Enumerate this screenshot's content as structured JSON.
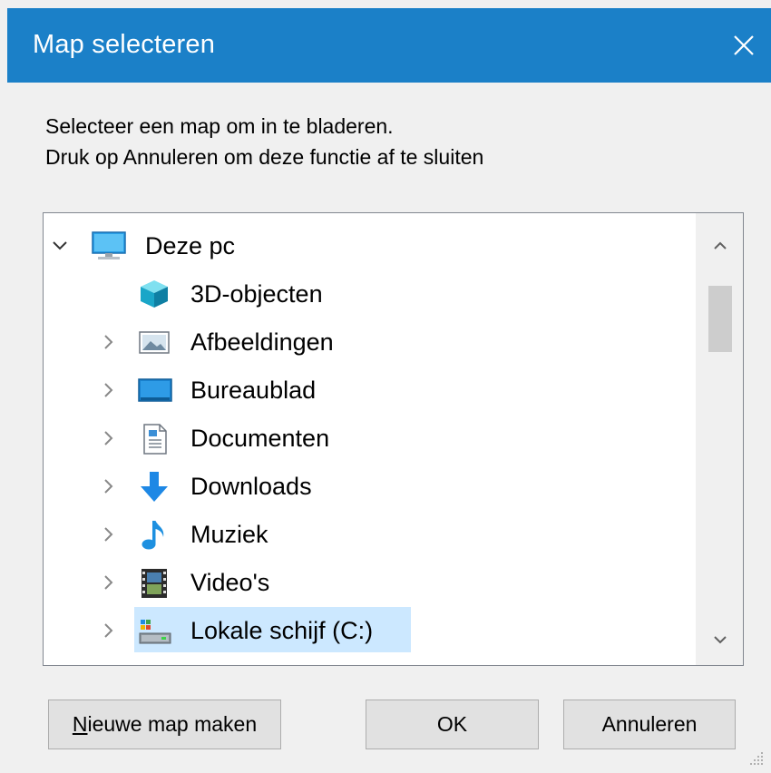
{
  "window": {
    "title": "Map selecteren",
    "accent_color": "#1b80c8"
  },
  "instructions": {
    "line1": "Selecteer een map om in te bladeren.",
    "line2": "Druk op Annuleren om deze functie af te sluiten"
  },
  "tree": {
    "root": {
      "label": "Deze pc",
      "icon": "monitor-icon",
      "expanded": true
    },
    "items": [
      {
        "label": "3D-objecten",
        "icon": "cube-3d-icon",
        "has_children": false
      },
      {
        "label": "Afbeeldingen",
        "icon": "pictures-folder-icon",
        "has_children": true
      },
      {
        "label": "Bureaublad",
        "icon": "desktop-folder-icon",
        "has_children": true
      },
      {
        "label": "Documenten",
        "icon": "documents-folder-icon",
        "has_children": true
      },
      {
        "label": "Downloads",
        "icon": "download-arrow-icon",
        "has_children": true
      },
      {
        "label": "Muziek",
        "icon": "music-note-icon",
        "has_children": true
      },
      {
        "label": "Video's",
        "icon": "video-film-icon",
        "has_children": true
      },
      {
        "label": "Lokale schijf (C:)",
        "icon": "local-drive-icon",
        "has_children": true,
        "selected": true
      }
    ]
  },
  "buttons": {
    "new_folder_prefix": "N",
    "new_folder_rest": "ieuwe map maken",
    "ok": "OK",
    "cancel": "Annuleren"
  }
}
